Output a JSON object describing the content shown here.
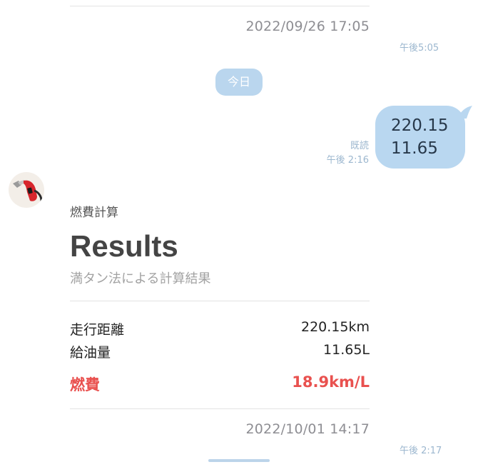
{
  "previous_card": {
    "date": "2022/09/26 17:05",
    "time": "午後5:05"
  },
  "date_separator": "今日",
  "sent_message": {
    "lines": [
      "220.15",
      "11.65"
    ],
    "read_label": "既読",
    "time": "午後 2:16"
  },
  "bot": {
    "avatar_icon": "fuel-nozzle-icon",
    "name": "燃費計算"
  },
  "result_card": {
    "title": "Results",
    "subtitle": "満タン法による計算結果",
    "rows": [
      {
        "label": "走行距離",
        "value": "220.15km"
      },
      {
        "label": "給油量",
        "value": "11.65L"
      },
      {
        "label": "燃費",
        "value": "18.9km/L"
      }
    ],
    "date": "2022/10/01 14:17",
    "time": "午後 2:17"
  },
  "colors": {
    "bubble": "#b9d7f0",
    "accent_red": "#e9514f",
    "pill": "#bad6ee"
  }
}
